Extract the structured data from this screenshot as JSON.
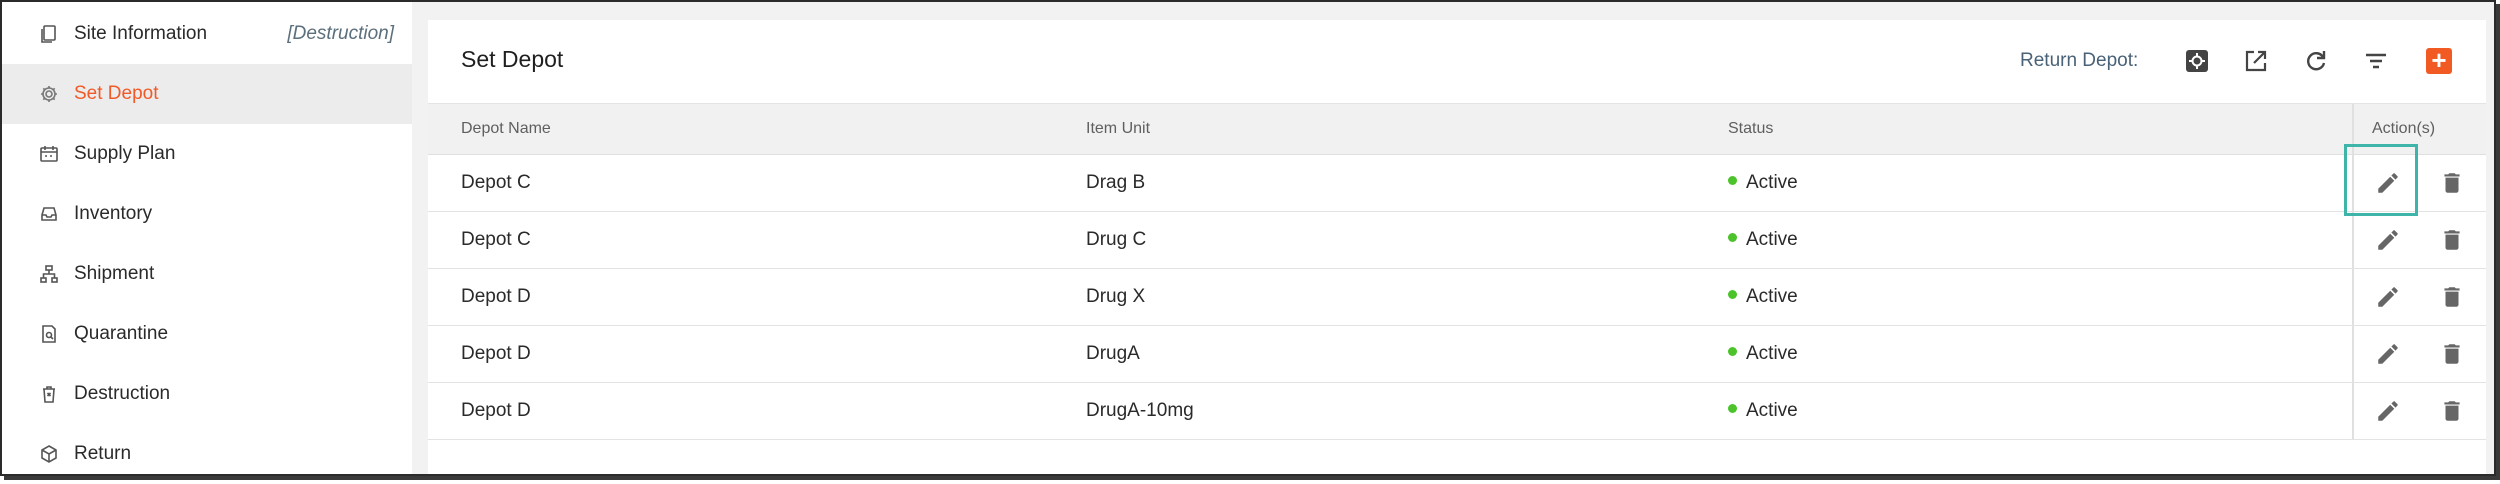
{
  "sidebar": {
    "items": [
      {
        "label": "Site Information",
        "extra": "[Destruction]",
        "icon": "document-icon"
      },
      {
        "label": "Set Depot",
        "icon": "gear-icon",
        "active": true
      },
      {
        "label": "Supply Plan",
        "icon": "calendar-icon"
      },
      {
        "label": "Inventory",
        "icon": "inbox-icon"
      },
      {
        "label": "Shipment",
        "icon": "hierarchy-icon"
      },
      {
        "label": "Quarantine",
        "icon": "document-search-icon"
      },
      {
        "label": "Destruction",
        "icon": "trash-icon"
      },
      {
        "label": "Return",
        "icon": "box-icon"
      }
    ]
  },
  "header": {
    "title": "Set Depot",
    "return_label": "Return Depot:",
    "tools": [
      "settings-icon",
      "open-external-icon",
      "refresh-icon",
      "filter-icon",
      "add-icon"
    ],
    "add_label": "+"
  },
  "table": {
    "columns": [
      "Depot Name",
      "Item Unit",
      "Status",
      "Action(s)"
    ],
    "rows": [
      {
        "depot": "Depot C",
        "item": "Drag B",
        "status": "Active"
      },
      {
        "depot": "Depot C",
        "item": "Drug C",
        "status": "Active"
      },
      {
        "depot": "Depot D",
        "item": "Drug X",
        "status": "Active"
      },
      {
        "depot": "Depot D",
        "item": "DrugA",
        "status": "Active"
      },
      {
        "depot": "Depot D",
        "item": "DrugA-10mg",
        "status": "Active"
      }
    ]
  },
  "colors": {
    "accent": "#f05a28",
    "active_status": "#4cc32a",
    "highlight": "#3fb4a8"
  }
}
